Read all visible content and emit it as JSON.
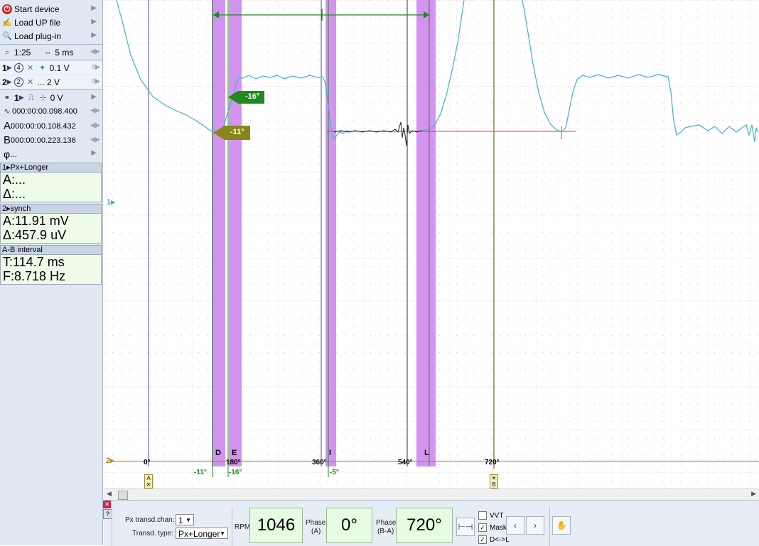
{
  "sidebar": {
    "start_device": "Start device",
    "load_up_file": "Load UP file",
    "load_plugin": "Load plug-in",
    "zoom": "1:25",
    "time_div": "5 ms",
    "ch1": {
      "num": "1",
      "inner": "4",
      "value": "0.1 V"
    },
    "ch2": {
      "num": "2",
      "inner": "2",
      "value": "... 2 V"
    },
    "trigger": {
      "num": "1",
      "value": "0 V"
    },
    "trigger_time": "000:00:00.098.400",
    "cursor_a": {
      "label": "A",
      "value": "000:00:00.108.432"
    },
    "cursor_b": {
      "label": "B",
      "value": "000:00:00.223.136"
    },
    "phi": {
      "label": "φ",
      "value": "..."
    },
    "panels": [
      {
        "header": "1▸Px+Longer",
        "line1": "A:...",
        "line2": "Δ:..."
      },
      {
        "header": "2▸synch",
        "line1": "A:11.91 mV",
        "line2": "Δ:457.9 uV"
      },
      {
        "header": "A-B interval",
        "line1": " T:114.7 ms",
        "line2": "F:8.718 Hz"
      }
    ]
  },
  "scope": {
    "ch1_marker": "1▸",
    "ch2_marker": "2▸",
    "markers": {
      "d": "D",
      "e": "E",
      "i": "I",
      "l": "L"
    },
    "angles": {
      "a0": "0°",
      "a180": "180°",
      "a360": "360°",
      "a540": "540°",
      "a720": "720°"
    },
    "sub_angles": {
      "m11": "-11°",
      "m16": "-16°",
      "m5": "-5°"
    },
    "flags": {
      "f16": "-16°",
      "f11": "-11°"
    },
    "cursor_tags": {
      "a": "A",
      "b": "B"
    }
  },
  "bottom": {
    "px_transd_chan_label": "Px transd.chan:",
    "px_transd_chan_value": "1",
    "transd_type_label": "Transd. type:",
    "transd_type_value": "Px+Longer",
    "rpm_label": "RPM:",
    "rpm_value": "1046",
    "phase_a_label": "Phase:",
    "phase_a_sub": "(A)",
    "phase_a_value": "0°",
    "phase_ba_label": "Phase:",
    "phase_ba_sub": "(B-A)",
    "phase_ba_value": "720°",
    "vvt_label": "VVT",
    "mask_label": "Mask",
    "dl_label": "D<->L",
    "vvt_checked": false,
    "mask_checked": true,
    "dl_checked": true
  },
  "colors": {
    "trace_cyan": "#3bb5c4",
    "marker_purple": "#cc80ee",
    "green": "#1f8a1f",
    "olive": "#86861a",
    "brown": "#b07a30",
    "red": "#e03a3a"
  }
}
